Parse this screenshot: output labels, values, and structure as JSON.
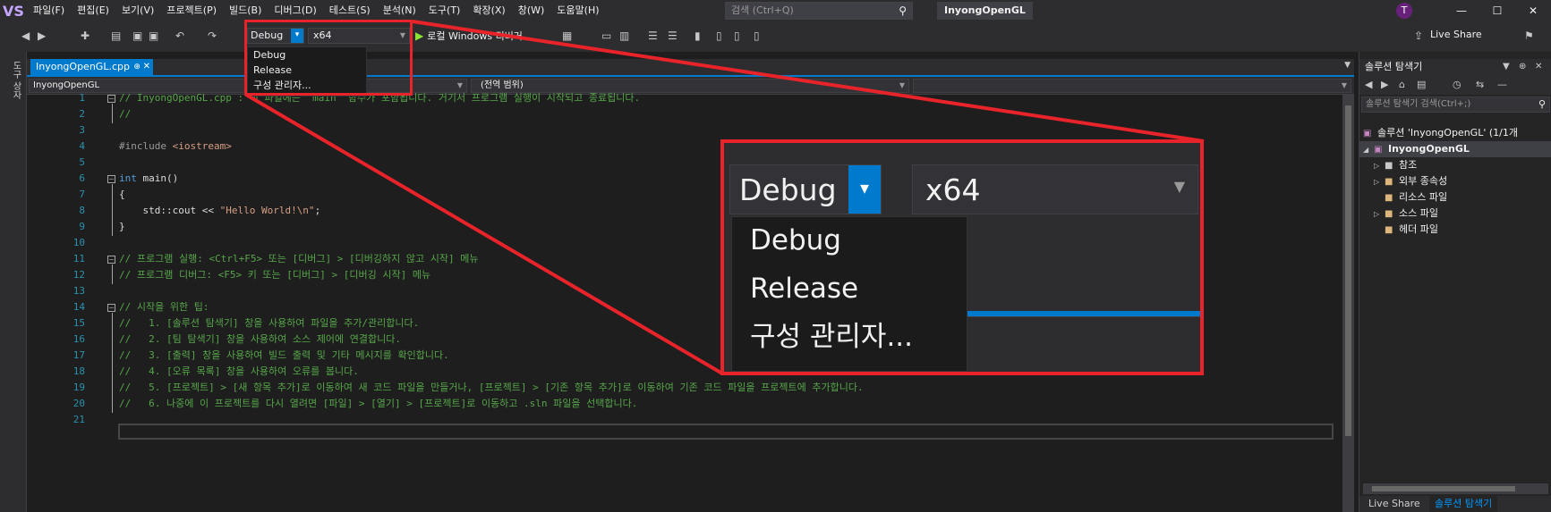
{
  "menubar": {
    "logo": "VS",
    "items": [
      "파일(F)",
      "편집(E)",
      "보기(V)",
      "프로젝트(P)",
      "빌드(B)",
      "디버그(D)",
      "테스트(S)",
      "분석(N)",
      "도구(T)",
      "확장(X)",
      "창(W)",
      "도움말(H)"
    ],
    "search_placeholder": "검색 (Ctrl+Q)",
    "solution_name": "InyongOpenGL",
    "avatar_initial": "T",
    "minimize": "—",
    "maximize": "☐",
    "close": "✕"
  },
  "toolbar": {
    "config_value": "Debug",
    "platform_value": "x64",
    "run_label": "로컬 Windows 디버거",
    "live_share": "Live Share"
  },
  "left_strip": {
    "label": "도구 상자"
  },
  "editor": {
    "tab_label": "InyongOpenGL.cpp",
    "tab_pin": "⊕",
    "tab_close": "✕",
    "nav_project": "InyongOpenGL",
    "nav_scope": "(전역 범위)",
    "line_numbers": [
      "1",
      "2",
      "3",
      "4",
      "5",
      "6",
      "7",
      "8",
      "9",
      "10",
      "11",
      "12",
      "13",
      "14",
      "15",
      "16",
      "17",
      "18",
      "19",
      "20",
      "21"
    ],
    "lines": {
      "l1": "// InyongOpenGL.cpp : 이 파일에는 'main' 함수가 포함됩니다. 거기서 프로그램 실행이 시작되고 종료됩니다.",
      "l2": "//",
      "l4_pp": "#include ",
      "l4_hdr": "<iostream>",
      "l6_kw": "int",
      "l6_rest": " main()",
      "l7": "{",
      "l8_a": "    std::cout << ",
      "l8_str": "\"Hello World!\\n\"",
      "l8_b": ";",
      "l9": "}",
      "l11": "// 프로그램 실행: <Ctrl+F5> 또는 [디버그] > [디버깅하지 않고 시작] 메뉴",
      "l12": "// 프로그램 디버그: <F5> 키 또는 [디버그] > [디버깅 시작] 메뉴",
      "l14": "// 시작을 위한 팁:",
      "l15": "//   1. [솔루션 탐색기] 창을 사용하여 파일을 추가/관리합니다.",
      "l16": "//   2. [팀 탐색기] 창을 사용하여 소스 제어에 연결합니다.",
      "l17": "//   3. [출력] 창을 사용하여 빌드 출력 및 기타 메시지를 확인합니다.",
      "l18": "//   4. [오류 목록] 창을 사용하여 오류를 봅니다.",
      "l19": "//   5. [프로젝트] > [새 항목 추가]로 이동하여 새 코드 파일을 만들거나, [프로젝트] > [기존 항목 추가]로 이동하여 기존 코드 파일을 프로젝트에 추가합니다.",
      "l20": "//   6. 나중에 이 프로젝트를 다시 열려면 [파일] > [열기] > [프로젝트]로 이동하고 .sln 파일을 선택합니다."
    }
  },
  "config_menu": {
    "options": [
      "Debug",
      "Release",
      "구성 관리자..."
    ]
  },
  "zoom": {
    "config_value": "Debug",
    "platform_value": "x64",
    "options": [
      "Debug",
      "Release",
      "구성 관리자..."
    ]
  },
  "solution_explorer": {
    "title": "솔루션 탐색기",
    "search_placeholder": "솔루션 탐색기 검색(Ctrl+;)",
    "solution_label": "솔루션 'InyongOpenGL' (1/1개",
    "project_label": "InyongOpenGL",
    "items": [
      "참조",
      "외부 종속성",
      "리소스 파일",
      "소스 파일",
      "헤더 파일"
    ],
    "bottom_tabs": [
      "Live Share",
      "솔루션 탐색기"
    ]
  },
  "colors": {
    "accent": "#007acc",
    "highlight_red": "#e8232a",
    "comment_green": "#57a64a",
    "keyword_blue": "#569cd6",
    "string_brown": "#d69d85",
    "line_number": "#2b91af"
  }
}
